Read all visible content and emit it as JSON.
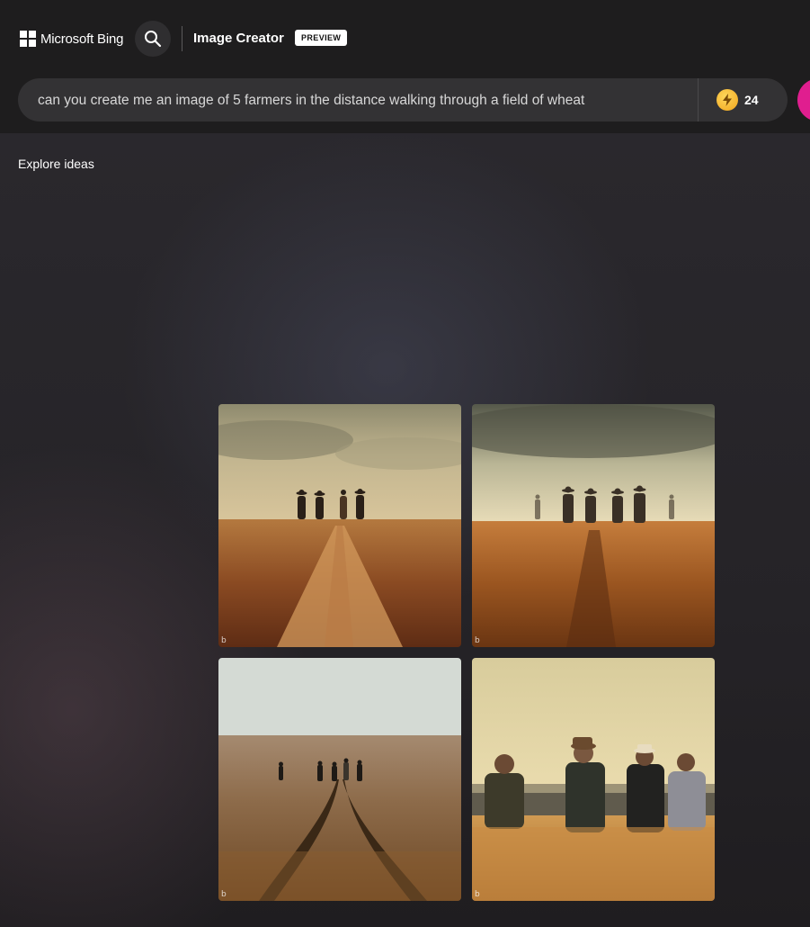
{
  "header": {
    "brand": "Microsoft Bing",
    "app_title": "Image Creator",
    "badge": "PREVIEW"
  },
  "prompt": {
    "value": "can you create me an image of 5 farmers in the distance walking through a field of wheat",
    "boost_count": "24"
  },
  "sidebar": {
    "explore_label": "Explore ideas"
  },
  "results": {
    "watermark": "b",
    "images": [
      {
        "name": "farmers-on-path-sunset"
      },
      {
        "name": "farmers-in-haze"
      },
      {
        "name": "farmers-twin-track-prairie"
      },
      {
        "name": "farmers-close-golden-hour"
      }
    ]
  },
  "colors": {
    "header_bg": "#1e1d1e",
    "prompt_bg": "#333234",
    "create_button": "#e01e8f",
    "boost_coin": "#f0a51d"
  }
}
